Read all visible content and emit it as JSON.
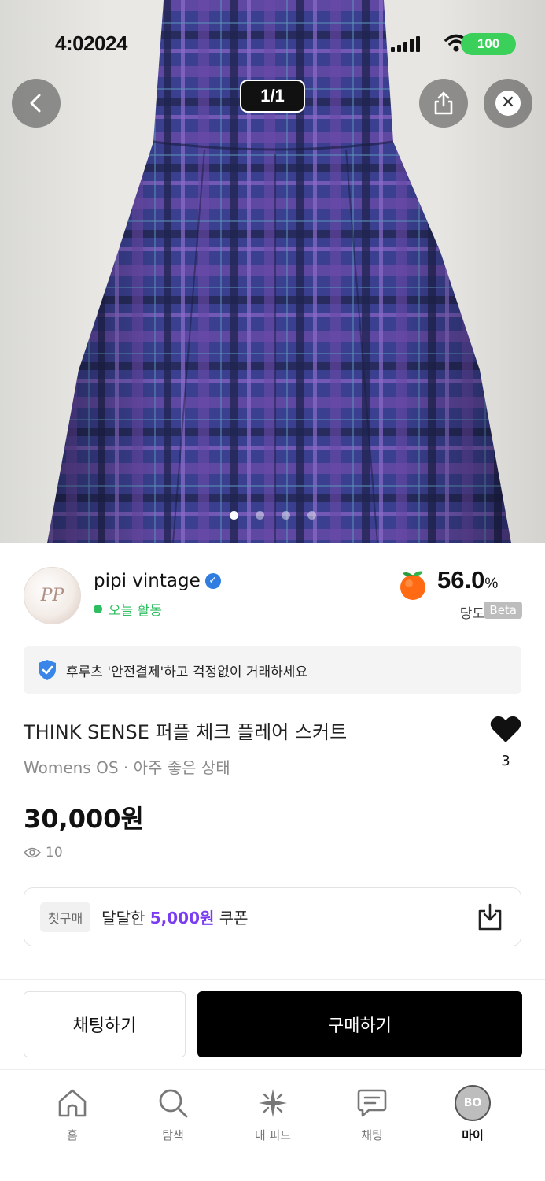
{
  "status_bar": {
    "time": "4:02024",
    "battery": "100"
  },
  "gallery": {
    "counter": "1/1",
    "page_count": 4,
    "active_page": 1
  },
  "seller": {
    "name": "pipi vintage",
    "avatar_initials": "PP",
    "activity": "오늘 활동",
    "sweetness_value": "56.0",
    "sweetness_unit": "%",
    "sweetness_label": "당도",
    "beta_badge": "Beta"
  },
  "notice": {
    "text": "후루츠 '안전결제'하고 걱정없이 거래하세요"
  },
  "product": {
    "title": "THINK SENSE 퍼플 체크 플레어 스커트",
    "meta": "Womens OS · 아주 좋은 상태",
    "price": "30,000원",
    "views": "10",
    "likes": "3"
  },
  "coupon": {
    "tag": "첫구매",
    "prefix": "달달한",
    "amount": "5,000원",
    "suffix": "쿠폰"
  },
  "actions": {
    "chat": "채팅하기",
    "buy": "구매하기"
  },
  "tabbar": {
    "items": [
      {
        "label": "홈",
        "icon": "home-icon"
      },
      {
        "label": "탐색",
        "icon": "search-icon"
      },
      {
        "label": "내 피드",
        "icon": "sparkle-icon"
      },
      {
        "label": "채팅",
        "icon": "chat-icon"
      },
      {
        "label": "마이",
        "icon": "avatar",
        "initials": "BO",
        "active": true
      }
    ]
  },
  "colors": {
    "accent_purple": "#7a3cf2",
    "activity_green": "#2dbe60",
    "verified_blue": "#2f7de1",
    "buy_button": "#000000"
  }
}
